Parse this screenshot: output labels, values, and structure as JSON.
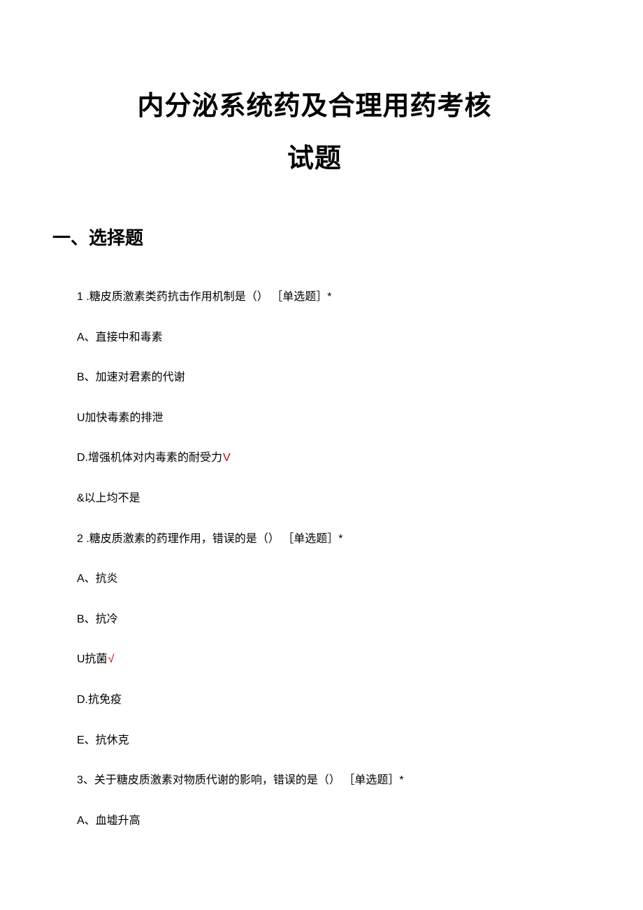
{
  "title": {
    "line1": "内分泌系统药及合理用药考核",
    "line2": "试题"
  },
  "sectionHeading": "一、选择题",
  "checkmark": "V",
  "checkmark_alt": "√",
  "questions": [
    {
      "prompt_num": "1",
      "prompt_text": " .糖皮质激素类药抗击作用机制是（） ［单选题］*",
      "options": [
        {
          "label": "A、直接中和毒素",
          "correct": false
        },
        {
          "label": "B、加速对君素的代谢",
          "correct": false
        },
        {
          "label": "U加快毒素的排泄",
          "correct": false
        },
        {
          "label": "D.增强机体对内毒素的耐受力",
          "correct": true,
          "mark": "V"
        },
        {
          "label": "&以上均不是",
          "correct": false
        }
      ]
    },
    {
      "prompt_num": "2",
      "prompt_text": " .糖皮质激素的药理作用，错误的是（） ［单选题］*",
      "options": [
        {
          "label": "A、抗炎",
          "correct": false
        },
        {
          "label": "B、抗冷",
          "correct": false
        },
        {
          "label": "U抗菌",
          "correct": true,
          "mark": "√"
        },
        {
          "label": "D.抗免疫",
          "correct": false
        },
        {
          "label": "E、抗休克",
          "correct": false
        }
      ]
    },
    {
      "prompt_num": "3、",
      "prompt_text": "关于糖皮质激素对物质代谢的影响，错误的是（） ［单选题］*",
      "options": [
        {
          "label": "A、血墟升高",
          "correct": false
        }
      ]
    }
  ]
}
